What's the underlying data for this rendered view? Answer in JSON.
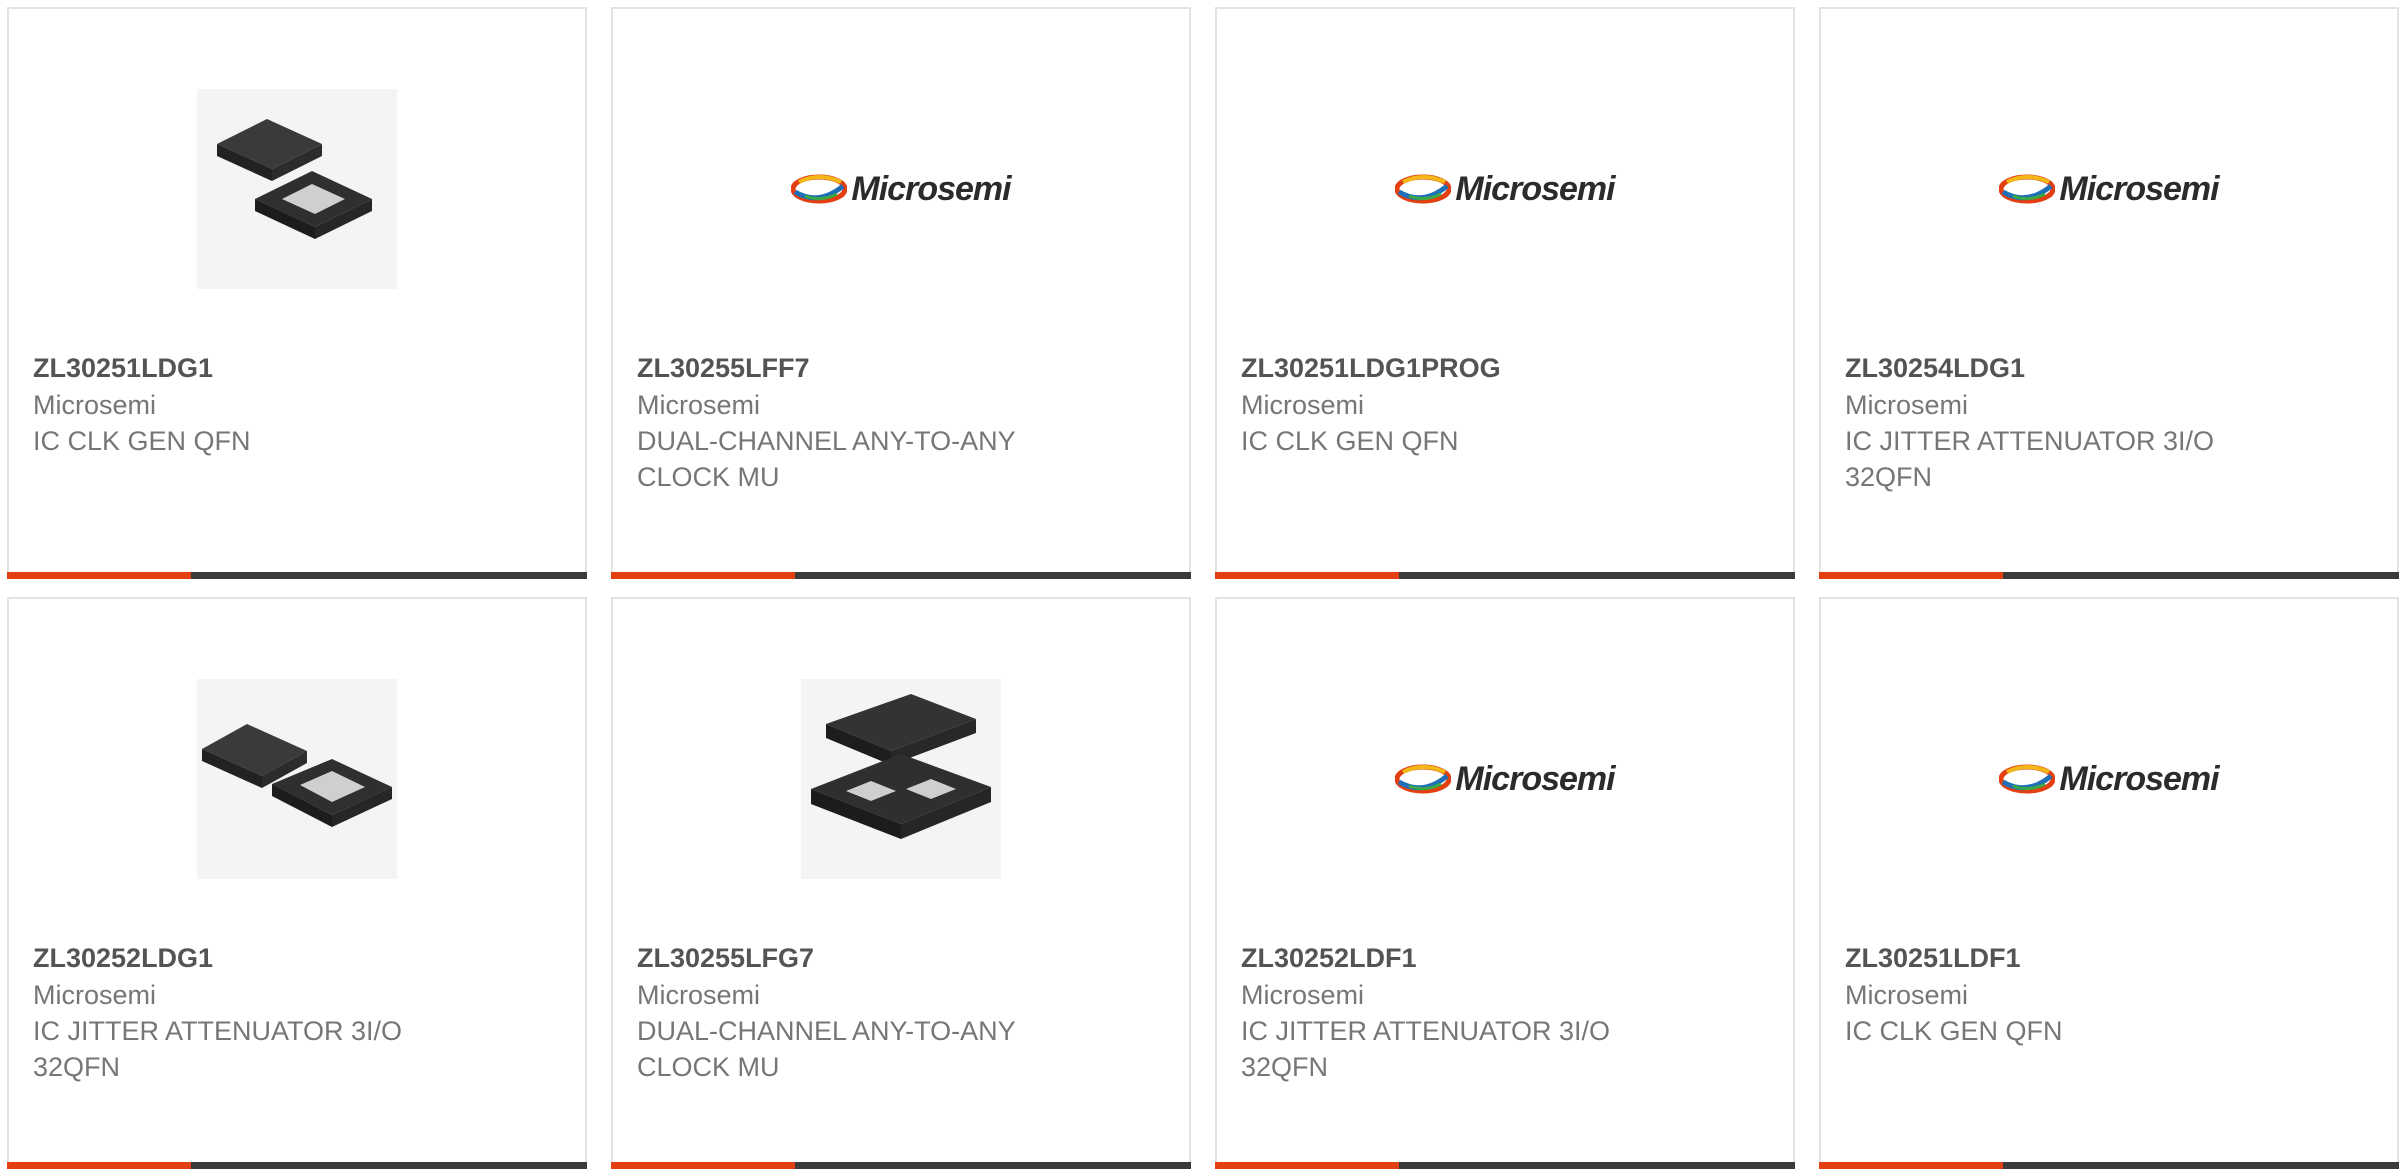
{
  "products": [
    {
      "part_number": "ZL30251LDG1",
      "manufacturer": "Microsemi",
      "description": "IC CLK GEN QFN",
      "image": "qfn-chip-pair-small"
    },
    {
      "part_number": "ZL30255LFF7",
      "manufacturer": "Microsemi",
      "description": "DUAL-CHANNEL ANY-TO-ANY CLOCK MU",
      "image": "microsemi-logo"
    },
    {
      "part_number": "ZL30251LDG1PROG",
      "manufacturer": "Microsemi",
      "description": "IC CLK GEN QFN",
      "image": "microsemi-logo"
    },
    {
      "part_number": "ZL30254LDG1",
      "manufacturer": "Microsemi",
      "description": "IC JITTER ATTENUATOR 3I/O 32QFN",
      "image": "microsemi-logo"
    },
    {
      "part_number": "ZL30252LDG1",
      "manufacturer": "Microsemi",
      "description": "IC JITTER ATTENUATOR 3I/O 32QFN",
      "image": "qfn-chip-pair-small"
    },
    {
      "part_number": "ZL30255LFG7",
      "manufacturer": "Microsemi",
      "description": "DUAL-CHANNEL ANY-TO-ANY CLOCK MU",
      "image": "qfn-chip-pair-large"
    },
    {
      "part_number": "ZL30252LDF1",
      "manufacturer": "Microsemi",
      "description": "IC JITTER ATTENUATOR 3I/O 32QFN",
      "image": "microsemi-logo"
    },
    {
      "part_number": "ZL30251LDF1",
      "manufacturer": "Microsemi",
      "description": "IC CLK GEN QFN",
      "image": "microsemi-logo"
    }
  ],
  "logo": {
    "text": "Microsemi"
  },
  "colors": {
    "accent": "#e34012",
    "bar": "#3b3b3b",
    "border": "#e2e2e2",
    "part_number": "#545454",
    "secondary_text": "#767676"
  }
}
